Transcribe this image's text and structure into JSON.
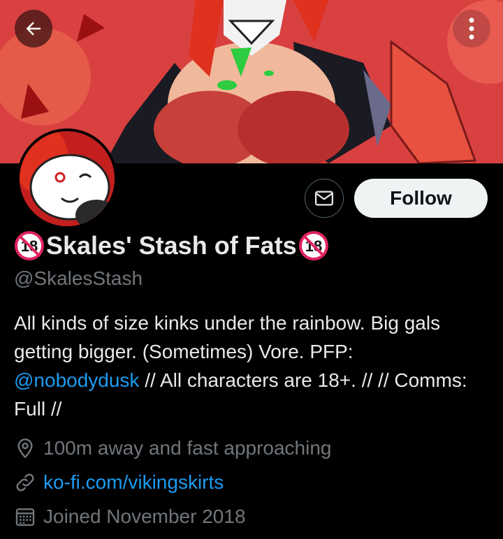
{
  "profile": {
    "display_name": "Skales' Stash of Fats",
    "badge_text": "18",
    "handle": "@SkalesStash",
    "follow_label": "Follow",
    "bio": {
      "part1": "All kinds of size kinks under the rainbow. Big gals getting bigger. (Sometimes) Vore. PFP: ",
      "mention": "@nobodydusk",
      "part2": " // All characters are 18+. // // Comms: Full //"
    },
    "location": "100m away and fast approaching",
    "website": "ko-fi.com/vikingskirts",
    "joined": "Joined November 2018"
  },
  "icons": {
    "back": "back-arrow-icon",
    "more": "more-vertical-icon",
    "message": "envelope-icon",
    "location": "location-pin-icon",
    "link": "link-icon",
    "calendar": "calendar-icon"
  },
  "colors": {
    "background": "#000000",
    "text": "#e7e9ea",
    "muted": "#71767b",
    "link": "#1d9bf0",
    "follow_bg": "#eff3f4",
    "banner_red": "#d63b3b",
    "badge_red": "#e0245e"
  }
}
